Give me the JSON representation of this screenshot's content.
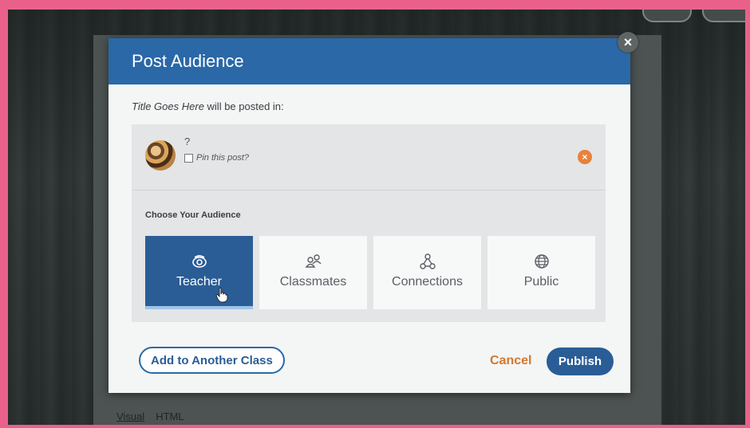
{
  "dialog": {
    "title": "Post Audience",
    "close_label": "×"
  },
  "intro": {
    "post_title": "Title Goes Here",
    "suffix": " will be posted in:"
  },
  "class_row": {
    "name": "?",
    "pin_label": "Pin this post?",
    "pin_checked": false,
    "remove_label": "×"
  },
  "audience": {
    "heading": "Choose Your Audience",
    "selected": "Teacher",
    "options": [
      {
        "label": "Teacher",
        "icon": "eye-icon"
      },
      {
        "label": "Classmates",
        "icon": "people-icon"
      },
      {
        "label": "Connections",
        "icon": "network-icon"
      },
      {
        "label": "Public",
        "icon": "globe-icon"
      }
    ]
  },
  "footer": {
    "add_class_label": "Add to Another Class",
    "cancel_label": "Cancel",
    "publish_label": "Publish"
  },
  "background": {
    "editor_tabs": [
      "Visual",
      "HTML"
    ]
  },
  "colors": {
    "header_blue": "#2a68a8",
    "selected_blue": "#2a5d96",
    "cancel_orange": "#d5782f",
    "frame_pink": "#e9618b"
  }
}
